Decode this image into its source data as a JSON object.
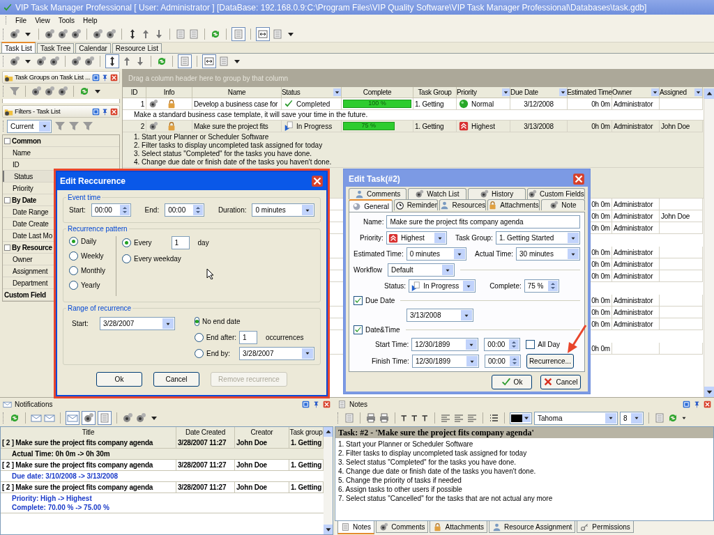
{
  "window": {
    "title": "VIP Task Manager Professional [ User: Administrator ] [DataBase: 192.168.0.9:C:\\Program Files\\VIP Quality Software\\VIP Task Manager Professional\\Databases\\task.gdb]"
  },
  "menu": [
    "File",
    "View",
    "Tools",
    "Help"
  ],
  "view_tabs": [
    {
      "label": "Task List",
      "selected": true
    },
    {
      "label": "Task Tree",
      "selected": false
    },
    {
      "label": "Calendar",
      "selected": false
    },
    {
      "label": "Resource List",
      "selected": false
    }
  ],
  "task_groups_panel": {
    "title": "Task Groups on Task List ..."
  },
  "filters_panel": {
    "title": "Filters - Task List",
    "filter": "Current",
    "groups": [
      {
        "label": "Common",
        "items": [
          {
            "label": "Name",
            "selected": false
          },
          {
            "label": "ID",
            "selected": false
          },
          {
            "label": "Status",
            "selected": true
          },
          {
            "label": "Priority",
            "selected": false
          }
        ]
      },
      {
        "label": "By Date",
        "items": [
          {
            "label": "Date Range",
            "selected": false
          },
          {
            "label": "Date Create",
            "selected": false
          },
          {
            "label": "Date Last Mo",
            "selected": false
          }
        ]
      },
      {
        "label": "By Resource",
        "items": [
          {
            "label": "Owner",
            "selected": false
          },
          {
            "label": "Assignment",
            "selected": false
          },
          {
            "label": "Department",
            "selected": false
          }
        ]
      },
      {
        "label": "Custom Field"
      }
    ]
  },
  "grid": {
    "group_hint": "Drag a column header here to group by that column",
    "columns": [
      "ID",
      "Info",
      "Name",
      "Status",
      "Complete",
      "Task Group",
      "Priority",
      "Due Date",
      "Estimated Time",
      "Owner",
      "Assigned"
    ],
    "rows": [
      {
        "id": "1",
        "name": "Develop a business case for",
        "status": {
          "label": "Completed",
          "kind": "completed"
        },
        "level": 1.0,
        "complete": "100 %",
        "group": "1. Getting",
        "priority": {
          "label": "Normal",
          "kind": "normal"
        },
        "due": "3/12/2008",
        "estimated": "0h 0m",
        "owner": "Administrator",
        "assigned": "",
        "selected": false,
        "notes": [
          "Make a standard business case template, it will save your time in the future."
        ]
      },
      {
        "id": "2",
        "name": "Make sure the project fits",
        "status": {
          "label": "In Progress",
          "kind": "progress"
        },
        "level": 0.75,
        "complete": "75 %",
        "group": "1. Getting",
        "priority": {
          "label": "Highest",
          "kind": "highest"
        },
        "due": "3/13/2008",
        "estimated": "0h 0m",
        "owner": "Administrator",
        "assigned": "John Doe",
        "selected": true,
        "notes": [
          "1. Start your Planner or Scheduler Software",
          "2. Filter tasks to display uncompleted task assigned for today",
          "3. Select status \"Completed\" for the tasks you have done.",
          "4. Change due date or finish date of the tasks you haven't done."
        ]
      }
    ],
    "covered_rows": [
      {
        "estimated": "0h 0m",
        "owner": "Administrator",
        "assigned": ""
      },
      {
        "estimated": "0h 0m",
        "owner": "Administrator",
        "assigned": "John Doe"
      },
      {
        "estimated": "0h 0m",
        "owner": "Administrator",
        "assigned": ""
      },
      {
        "estimated": "0h 0m",
        "owner": "Administrator",
        "assigned": ""
      },
      {
        "estimated": "0h 0m",
        "owner": "Administrator",
        "assigned": ""
      },
      {
        "estimated": "0h 0m",
        "owner": "Administrator",
        "assigned": ""
      },
      {
        "estimated": "0h 0m",
        "owner": "Administrator",
        "assigned": ""
      },
      {
        "estimated": "0h 0m",
        "owner": "Administrator",
        "assigned": ""
      },
      {
        "estimated": "0h 0m",
        "owner": "Administrator",
        "assigned": ""
      },
      {
        "estimated": "0h 0m",
        "owner": "",
        "assigned": ""
      }
    ]
  },
  "recurrence_dialog": {
    "title": "Edit Reccurence",
    "event_time": {
      "legend": "Event time",
      "start_label": "Start:",
      "start": "00:00",
      "end_label": "End:",
      "end": "00:00",
      "duration_label": "Duration:",
      "duration": "0 minutes"
    },
    "pattern": {
      "legend": "Recurrence pattern",
      "types": [
        {
          "label": "Daily",
          "selected": true
        },
        {
          "label": "Weekly",
          "selected": false
        },
        {
          "label": "Monthly",
          "selected": false
        },
        {
          "label": "Yearly",
          "selected": false
        }
      ],
      "options": [
        {
          "label": "Every",
          "selected": true,
          "value": "1",
          "unit": "day"
        },
        {
          "label": "Every weekday",
          "selected": false
        }
      ]
    },
    "range": {
      "legend": "Range of recurrence",
      "start_label": "Start:",
      "start": "3/28/2007",
      "ends": [
        {
          "kind": "none",
          "label": "No end date",
          "selected": true
        },
        {
          "kind": "count",
          "label": "End after:",
          "selected": false,
          "value": "1",
          "unit": "occurrences"
        },
        {
          "kind": "date",
          "label": "End by:",
          "selected": false,
          "value": "3/28/2007"
        }
      ]
    },
    "buttons": [
      {
        "label": "Ok",
        "disabled": false
      },
      {
        "label": "Cancel",
        "disabled": false
      },
      {
        "label": "Remove recurrence",
        "disabled": true
      }
    ]
  },
  "task_dialog": {
    "title": "Edit Task(#2)",
    "tabs_back": [
      {
        "label": "Comments",
        "selected": false
      },
      {
        "label": "Watch List",
        "selected": false
      },
      {
        "label": "History",
        "selected": false
      },
      {
        "label": "Custom Fields",
        "selected": false
      }
    ],
    "tabs_front": [
      {
        "label": "General",
        "selected": true
      },
      {
        "label": "Reminder",
        "selected": false
      },
      {
        "label": "Resources",
        "selected": false
      },
      {
        "label": "Attachments",
        "selected": false
      },
      {
        "label": "Note",
        "selected": false
      }
    ],
    "name_label": "Name:",
    "name": "Make sure the project fits company agenda",
    "priority_label": "Priority:",
    "priority": "Highest",
    "group_label": "Task Group:",
    "group": "1. Getting Started",
    "estimated_label": "Estimated Time:",
    "estimated": "0 minutes",
    "actual_label": "Actual Time:",
    "actual": "30 minutes",
    "workflow_label": "Workflow",
    "workflow": "Default",
    "status_label": "Status:",
    "status": "In Progress",
    "complete_label": "Complete:",
    "complete": "75 %",
    "due_date": {
      "label": "Due Date",
      "checked": true,
      "value": "3/13/2008"
    },
    "date_time": {
      "label": "Date&Time",
      "checked": true
    },
    "start_label": "Start Time:",
    "start_date": "12/30/1899",
    "start_time": "00:00",
    "all_day": {
      "label": "All Day",
      "checked": false
    },
    "finish_label": "Finish Time:",
    "finish_date": "12/30/1899",
    "finish_time": "00:00",
    "recurrence_button": "Recurrence...",
    "ok": "Ok",
    "cancel": "Cancel"
  },
  "notifications": {
    "title": "Notifications",
    "columns": [
      "Title",
      "Date Created",
      "Creator",
      "Task group"
    ],
    "items": [
      {
        "title": "[ 2 ] Make sure the project fits company agenda",
        "date": "3/28/2007 11:27",
        "creator": "John Doe",
        "group": "1. Getting",
        "selected": true,
        "details": [
          "Actual Time: 0h 0m -> 0h 30m"
        ]
      },
      {
        "title": "[ 2 ] Make sure the project fits company agenda",
        "date": "3/28/2007 11:27",
        "creator": "John Doe",
        "group": "1. Getting",
        "selected": false,
        "details": [
          "Due date: 3/10/2008 -> 3/13/2008"
        ]
      },
      {
        "title": "[ 2 ] Make sure the project fits company agenda",
        "date": "3/28/2007 11:27",
        "creator": "John Doe",
        "group": "1. Getting",
        "selected": false,
        "details": [
          "Priority: High -> Highest",
          "Complete: 70.00 % -> 75.00 %"
        ]
      }
    ]
  },
  "notes": {
    "title": "Notes",
    "font": "Tahoma",
    "size": "8",
    "heading": "Task: #2 - 'Make sure the project fits company agenda'",
    "lines": [
      "1. Start your Planner or Scheduler Software",
      "2. Filter tasks to display uncompleted task assigned for today",
      "3. Select status \"Completed\" for the tasks you have done.",
      "4. Change due date or finish date of the tasks you haven't done.",
      "5. Change the priority of tasks if needed",
      "6. Assign tasks to other users if possible",
      "7. Select status \"Cancelled\" for the tasks that are not actual any more"
    ],
    "tabs": [
      {
        "label": "Notes",
        "selected": true
      },
      {
        "label": "Comments",
        "selected": false
      },
      {
        "label": "Attachments",
        "selected": false
      },
      {
        "label": "Resource Assignment",
        "selected": false
      },
      {
        "label": "Permissions",
        "selected": false
      }
    ]
  }
}
